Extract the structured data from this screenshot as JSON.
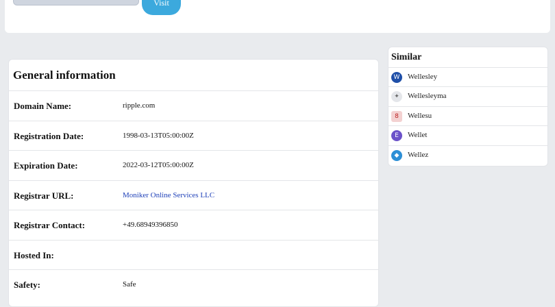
{
  "top": {
    "visit_label": "Visit"
  },
  "general": {
    "title": "General information",
    "rows": [
      {
        "label": "Domain Name:",
        "value": "ripple.com"
      },
      {
        "label": "Registration Date:",
        "value": "1998-03-13T05:00:00Z"
      },
      {
        "label": "Expiration Date:",
        "value": "2022-03-12T05:00:00Z"
      },
      {
        "label": "Registrar URL:",
        "value": "Moniker Online Services LLC"
      },
      {
        "label": "Registrar Contact:",
        "value": "+49.68949396850"
      },
      {
        "label": "Hosted In:",
        "value": ""
      },
      {
        "label": "Safety:",
        "value": "Safe"
      }
    ]
  },
  "similar": {
    "title": "Similar",
    "items": [
      {
        "name": "Wellesley",
        "icon": "w-logo-icon",
        "glyph": "W",
        "color": "#1f4fa8"
      },
      {
        "name": "Wellesleyma",
        "icon": "star-logo-icon",
        "glyph": "✦",
        "color": "#d0d3d8"
      },
      {
        "name": "Wellesu",
        "icon": "badge-logo-icon",
        "glyph": "8",
        "color": "#e7b3b3"
      },
      {
        "name": "Wellet",
        "icon": "wallet-logo-icon",
        "glyph": "E",
        "color": "#6b52c9"
      },
      {
        "name": "Wellez",
        "icon": "diamond-logo-icon",
        "glyph": "◆",
        "color": "#2d8fd6"
      }
    ]
  }
}
